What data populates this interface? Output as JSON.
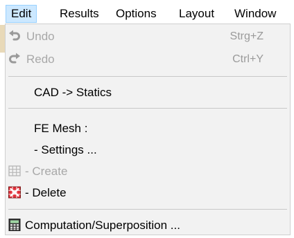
{
  "menubar": {
    "items": [
      {
        "label": "Edit",
        "active": true
      },
      {
        "label": "Results"
      },
      {
        "label": "Options"
      },
      {
        "label": "Layout"
      },
      {
        "label": "Window"
      }
    ]
  },
  "edit_menu": {
    "undo": {
      "label": "Undo",
      "shortcut": "Strg+Z",
      "icon": "undo-icon",
      "enabled": false
    },
    "redo": {
      "label": "Redo",
      "shortcut": "Ctrl+Y",
      "icon": "redo-icon",
      "enabled": false
    },
    "cad_statics": {
      "label": "CAD -> Statics"
    },
    "fe_mesh_header": {
      "label": "FE Mesh :"
    },
    "settings": {
      "label": "- Settings ..."
    },
    "create": {
      "label": "- Create",
      "icon": "grid-icon",
      "enabled": false
    },
    "delete": {
      "label": "- Delete",
      "icon": "delete-mesh-icon",
      "enabled": true
    },
    "computation": {
      "label": "Computation/Superposition ...",
      "icon": "calculator-icon"
    }
  },
  "colors": {
    "menu_bg": "#f2f2f2",
    "active_highlight": "#cce8ff",
    "disabled_text": "#a8a8a8",
    "delete_icon_red": "#e0303a"
  }
}
